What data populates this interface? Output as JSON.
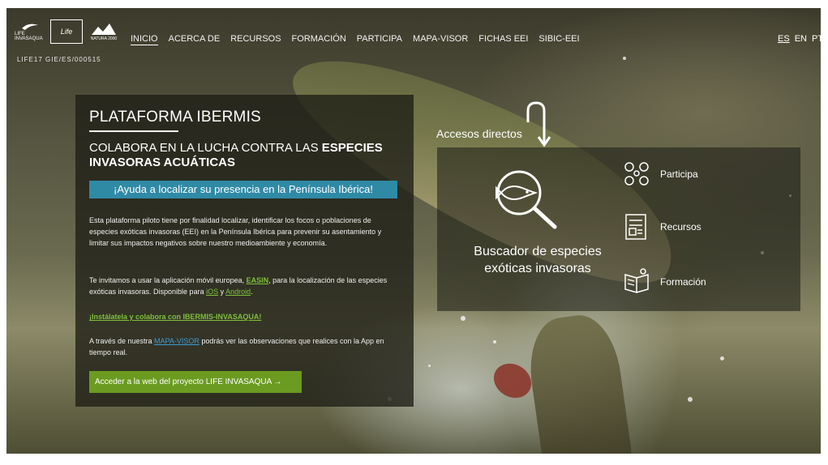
{
  "header": {
    "logo_text": "LIFE INVASAQUA",
    "life_label": "Life",
    "natura_label": "NATURA 2000",
    "life_code": "LIFE17 GIE/ES/000515",
    "menu": [
      "INICIO",
      "ACERCA DE",
      "RECURSOS",
      "FORMACIÓN",
      "PARTICIPA",
      "MAPA-VISOR",
      "FICHAS EEI",
      "SIBIC-EEI"
    ],
    "languages": [
      "ES",
      "EN",
      "PT"
    ]
  },
  "panel": {
    "title": "PLATAFORMA IBERMIS",
    "subtitle_plain": "COLABORA EN LA LUCHA CONTRA LAS ",
    "subtitle_bold1": "ESPECIES",
    "subtitle_bold2": "INVASORAS ACUÁTICAS",
    "banner": "¡Ayuda a localizar su presencia en la Península Ibérica!",
    "paragraph1": "Esta plataforma piloto tiene por finalidad localizar, identificar los focos o poblaciones de especies exóticas invasoras (EEI) en la Península Ibérica para prevenir su asentamiento y limitar sus impactos negativos sobre nuestro medioambiente y economía.",
    "p2_a": "Te invitamos a usar la aplicación móvil europea, ",
    "p2_link": "EASIN",
    "p2_b": ", para la localización de las especies exóticas invasoras.  Disponible para ",
    "p2_ios": "iOS",
    "p2_y": " y ",
    "p2_android": "Android",
    "p2_end": ".",
    "install_link": "¡Instálatela y colabora con IBERMIS-INVASAQUA!",
    "p3_a": "A través de nuestra ",
    "p3_link": "MAPA-VISOR",
    "p3_b": "  podrás ver las observaciones que realices con la App en tiempo real.",
    "button": "Acceder a la web del proyecto LIFE INVASAQUA →"
  },
  "shortcuts": {
    "title": "Accesos directos",
    "search_label": "Buscador de especies exóticas invasoras",
    "items": [
      "Participa",
      "Recursos",
      "Formación"
    ]
  },
  "colors": {
    "banner": "#2f8aa6",
    "button": "#6b9b20",
    "link_green": "#7ec13b",
    "link_blue": "#3a9bd4"
  }
}
